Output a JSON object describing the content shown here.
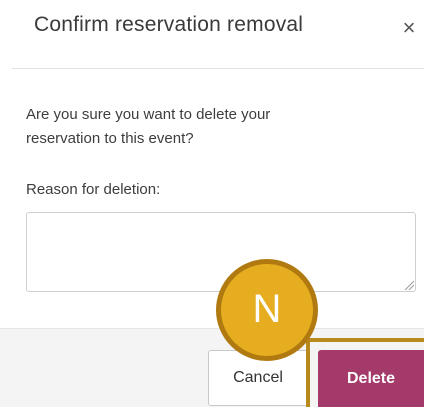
{
  "dialog": {
    "title": "Confirm reservation removal",
    "close_icon": "close-icon",
    "close_glyph": "×",
    "message": "Are you sure you want to delete your reservation to this event?",
    "reason_label": "Reason for deletion:",
    "reason_value": "",
    "cancel_label": "Cancel",
    "delete_label": "Delete"
  },
  "overlay": {
    "badge_letter": "N"
  },
  "colors": {
    "delete_button": "#a33a69",
    "badge_fill": "#e5ad1f",
    "badge_border": "#b07a10",
    "highlight_frame": "#b8891b",
    "footer_bg": "#f4f4f4"
  }
}
